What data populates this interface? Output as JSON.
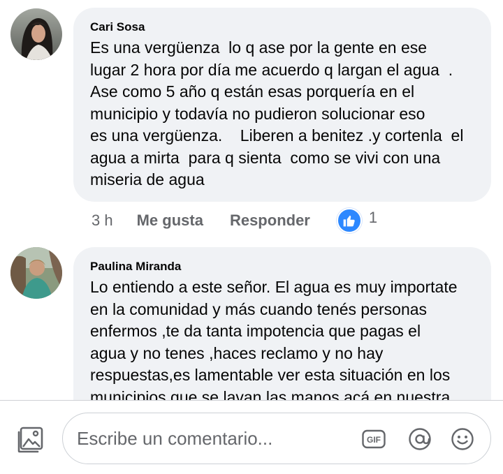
{
  "comments": [
    {
      "author": "Cari Sosa",
      "avatar_icon": "profile-photo",
      "lines": [
        "Es una vergüenza  lo q ase por la gente en ese",
        "lugar 2 hora por día me acuerdo q largan el agua  .",
        "Ase como 5 año q están esas porquería en el",
        "municipio y todavía no pudieron solucionar eso",
        "es una vergüenza.    Liberen a benitez .y cortenla  el",
        "agua a mirta  para q sienta  como se vivi con una",
        "miseria de agua"
      ],
      "time": "3 h",
      "like_label": "Me gusta",
      "reply_label": "Responder",
      "reaction_icon": "like-icon",
      "reaction_count": "1"
    },
    {
      "author": "Paulina Miranda",
      "avatar_icon": "profile-photo",
      "lines": [
        "Lo entiendo a este señor. El agua es muy importate",
        "en la comunidad y más cuando tenés personas",
        "enfermos ,te da tanta impotencia que pagas el",
        "agua y no tenes ,haces reclamo y no hay",
        "respuestas,es lamentable ver esta situación en los",
        "municipios que se lavan las manos acá en nuestra"
      ]
    }
  ],
  "composer": {
    "placeholder": "Escribe un comentario...",
    "value": "",
    "icons": [
      "photo-icon",
      "gif-icon",
      "mention-icon",
      "emoji-icon"
    ],
    "gif_label": "GIF"
  },
  "colors": {
    "bubble": "#f0f2f5",
    "text": "#050505",
    "meta": "#65676b",
    "like_blue": "#2d88ff"
  }
}
